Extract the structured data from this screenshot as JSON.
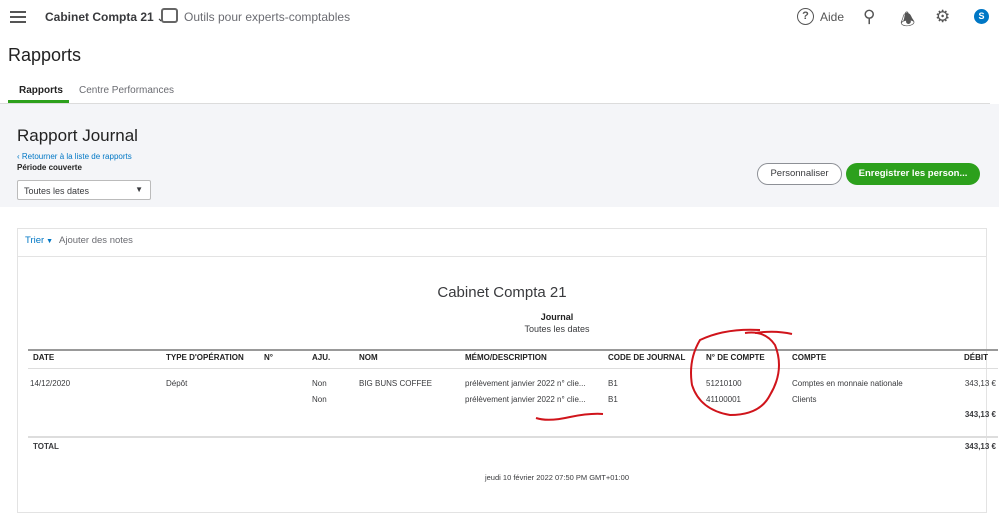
{
  "topbar": {
    "company": "Cabinet Compta 21",
    "tools": "Outils pour experts-comptables",
    "help": "Aide",
    "avatar": "S"
  },
  "page_title": "Rapports",
  "tabs": [
    {
      "label": "Rapports",
      "active": true
    },
    {
      "label": "Centre Performances",
      "active": false
    }
  ],
  "report": {
    "title": "Rapport Journal",
    "back_link": "Retourner à la liste de rapports",
    "period_label": "Période couverte",
    "period_value": "Toutes les dates",
    "customize": "Personnaliser",
    "save": "Enregistrer les person..."
  },
  "toolbar": {
    "sort": "Trier",
    "add_notes": "Ajouter des notes"
  },
  "doc": {
    "company": "Cabinet Compta 21",
    "name": "Journal",
    "period": "Toutes les dates",
    "columns": [
      "DATE",
      "TYPE D'OPÉRATION",
      "N°",
      "AJU.",
      "NOM",
      "MÉMO/DESCRIPTION",
      "CODE DE JOURNAL",
      "N° DE COMPTE",
      "COMPTE",
      "DÉBIT"
    ],
    "rows": [
      {
        "date": "14/12/2020",
        "type": "Dépôt",
        "num": "",
        "adj": "Non",
        "name": "BIG BUNS COFFEE",
        "memo": "prélèvement janvier 2022 n° clie...",
        "code": "B1",
        "account_no": "51210100",
        "account": "Comptes en monnaie nationale",
        "debit": "343,13 €"
      },
      {
        "date": "",
        "type": "",
        "num": "",
        "adj": "Non",
        "name": "",
        "memo": "prélèvement janvier 2022 n° clie...",
        "code": "B1",
        "account_no": "41100001",
        "account": "Clients",
        "debit": ""
      }
    ],
    "subtotal": "343,13 €",
    "total_label": "TOTAL",
    "total": "343,13 €",
    "footer": "jeudi 10 février 2022  07:50 PM GMT+01:00"
  },
  "colors": {
    "accent": "#2ca01c",
    "link": "#0077c5",
    "annotation": "#d0141b"
  }
}
